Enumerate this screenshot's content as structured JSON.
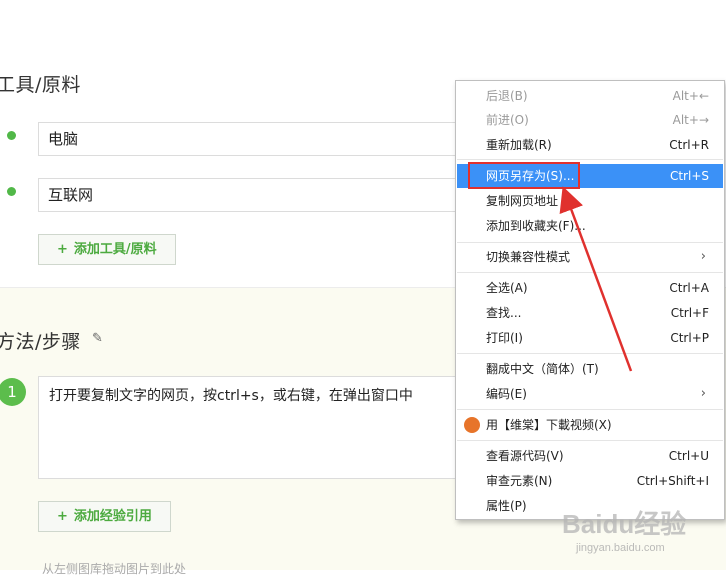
{
  "tools": {
    "title": "工具/原料",
    "items": [
      "电脑",
      "互联网"
    ],
    "add_button": "添加工具/原料"
  },
  "steps": {
    "title": "方法/步骤",
    "step_number": "1",
    "step_text": "打开要复制文字的网页，按ctrl+s，或右键，在弹出窗口中",
    "add_ref_button": "添加经验引用",
    "upload_hint": "从左侧图库拖动图片到此处"
  },
  "context_menu": {
    "items": [
      {
        "label": "后退(B)",
        "shortcut": "Alt+←"
      },
      {
        "label": "前进(O)",
        "shortcut": "Alt+→"
      },
      {
        "label": "重新加载(R)",
        "shortcut": "Ctrl+R"
      },
      {
        "label": "网页另存为(S)...",
        "shortcut": "Ctrl+S"
      },
      {
        "label": "复制网页地址",
        "shortcut": ""
      },
      {
        "label": "添加到收藏夹(F)...",
        "shortcut": ""
      },
      {
        "label": "切换兼容性模式",
        "shortcut": ""
      },
      {
        "label": "全选(A)",
        "shortcut": "Ctrl+A"
      },
      {
        "label": "查找...",
        "shortcut": "Ctrl+F"
      },
      {
        "label": "打印(I)",
        "shortcut": "Ctrl+P"
      },
      {
        "label": "翻成中文（简体）(T)",
        "shortcut": ""
      },
      {
        "label": "编码(E)",
        "shortcut": ""
      },
      {
        "label": "用【维棠】下載视频(X)",
        "shortcut": ""
      },
      {
        "label": "查看源代码(V)",
        "shortcut": "Ctrl+U"
      },
      {
        "label": "审查元素(N)",
        "shortcut": "Ctrl+Shift+I"
      },
      {
        "label": "属性(P)",
        "shortcut": ""
      }
    ],
    "submenu_arrow": "›"
  },
  "watermark": {
    "main": "Baidu经验",
    "sub": "jingyan.baidu.com"
  },
  "colors": {
    "accent_green": "#4caa3f",
    "highlight_blue": "#3b91f7",
    "annotation_red": "#e0312e"
  }
}
